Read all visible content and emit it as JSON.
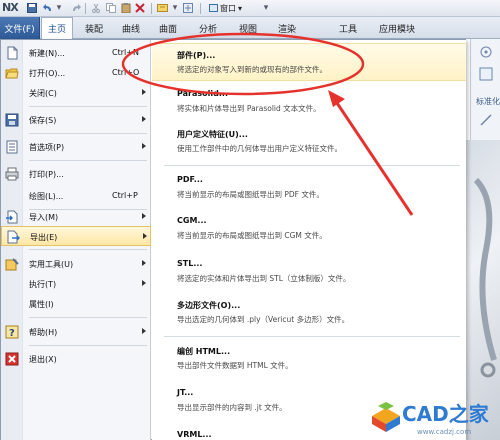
{
  "app": {
    "logo": "NX"
  },
  "window_menu": {
    "label": "窗口",
    "chevron": "▾"
  },
  "tabs": {
    "file": "文件(F)",
    "items": [
      "主页",
      "装配",
      "曲线",
      "曲面",
      "分析",
      "视图",
      "渲染",
      "工具",
      "应用模块"
    ],
    "active_index": 0
  },
  "menu": {
    "items": [
      {
        "label": "新建(N)...",
        "shortcut": "Ctrl+N",
        "icon": "new-file-icon"
      },
      {
        "label": "打开(O)...",
        "shortcut": "Ctrl+O",
        "icon": "open-folder-icon"
      },
      {
        "label": "关闭(C)",
        "submenu": true
      },
      {
        "label": "保存(S)",
        "submenu": true,
        "icon": "save-icon"
      },
      {
        "label": "首选项(P)",
        "submenu": true,
        "icon": "preferences-icon"
      },
      {
        "label": "打印(P)...",
        "icon": "printer-icon"
      },
      {
        "label": "绘图(L)...",
        "shortcut": "Ctrl+P"
      },
      {
        "label": "导入(M)",
        "submenu": true,
        "icon": "import-icon"
      },
      {
        "label": "导出(E)",
        "submenu": true,
        "selected": true,
        "icon": "export-icon"
      },
      {
        "label": "实用工具(U)",
        "submenu": true,
        "icon": "utilities-icon"
      },
      {
        "label": "执行(T)",
        "submenu": true
      },
      {
        "label": "属性(I)"
      },
      {
        "label": "帮助(H)",
        "submenu": true,
        "icon": "help-icon"
      },
      {
        "label": "退出(X)",
        "icon": "exit-icon"
      }
    ]
  },
  "export": {
    "items": [
      {
        "title": "部件(P)...",
        "desc": "将选定的对象写入到新的或现有的部件文件。"
      },
      {
        "title": "Parasolid...",
        "desc": "将实体和片体导出到 Parasolid 文本文件。"
      },
      {
        "title": "用户定义特征(U)...",
        "desc": "使用工作部件中的几何体导出用户定义特征文件。"
      },
      {
        "title": "PDF...",
        "desc": "将当前显示的布局或图纸导出到 PDF 文件。"
      },
      {
        "title": "CGM...",
        "desc": "将当前显示的布局或图纸导出到 CGM 文件。"
      },
      {
        "title": "STL...",
        "desc": "将选定的实体和片体导出到 STL（立体制版）文件。"
      },
      {
        "title": "多边形文件(O)...",
        "desc": "导出选定的几何体到 .ply（Vericut 多边形）文件。"
      },
      {
        "title": "编创 HTML...",
        "desc": "导出部件文件数据到 HTML 文件。"
      },
      {
        "title": "JT...",
        "desc": "导出显示部件的内容到 .jt 文件。"
      },
      {
        "title": "VRML..."
      }
    ]
  },
  "right_panel": {
    "label": "标准化"
  },
  "colors": {
    "file_tab": "#2d5a97",
    "selection": "#ffe7a4",
    "annotation": "#e5322d",
    "watermark": "#2e7bd1"
  },
  "watermark": {
    "text": "CAD之家",
    "url": "www.cadzj.com"
  }
}
